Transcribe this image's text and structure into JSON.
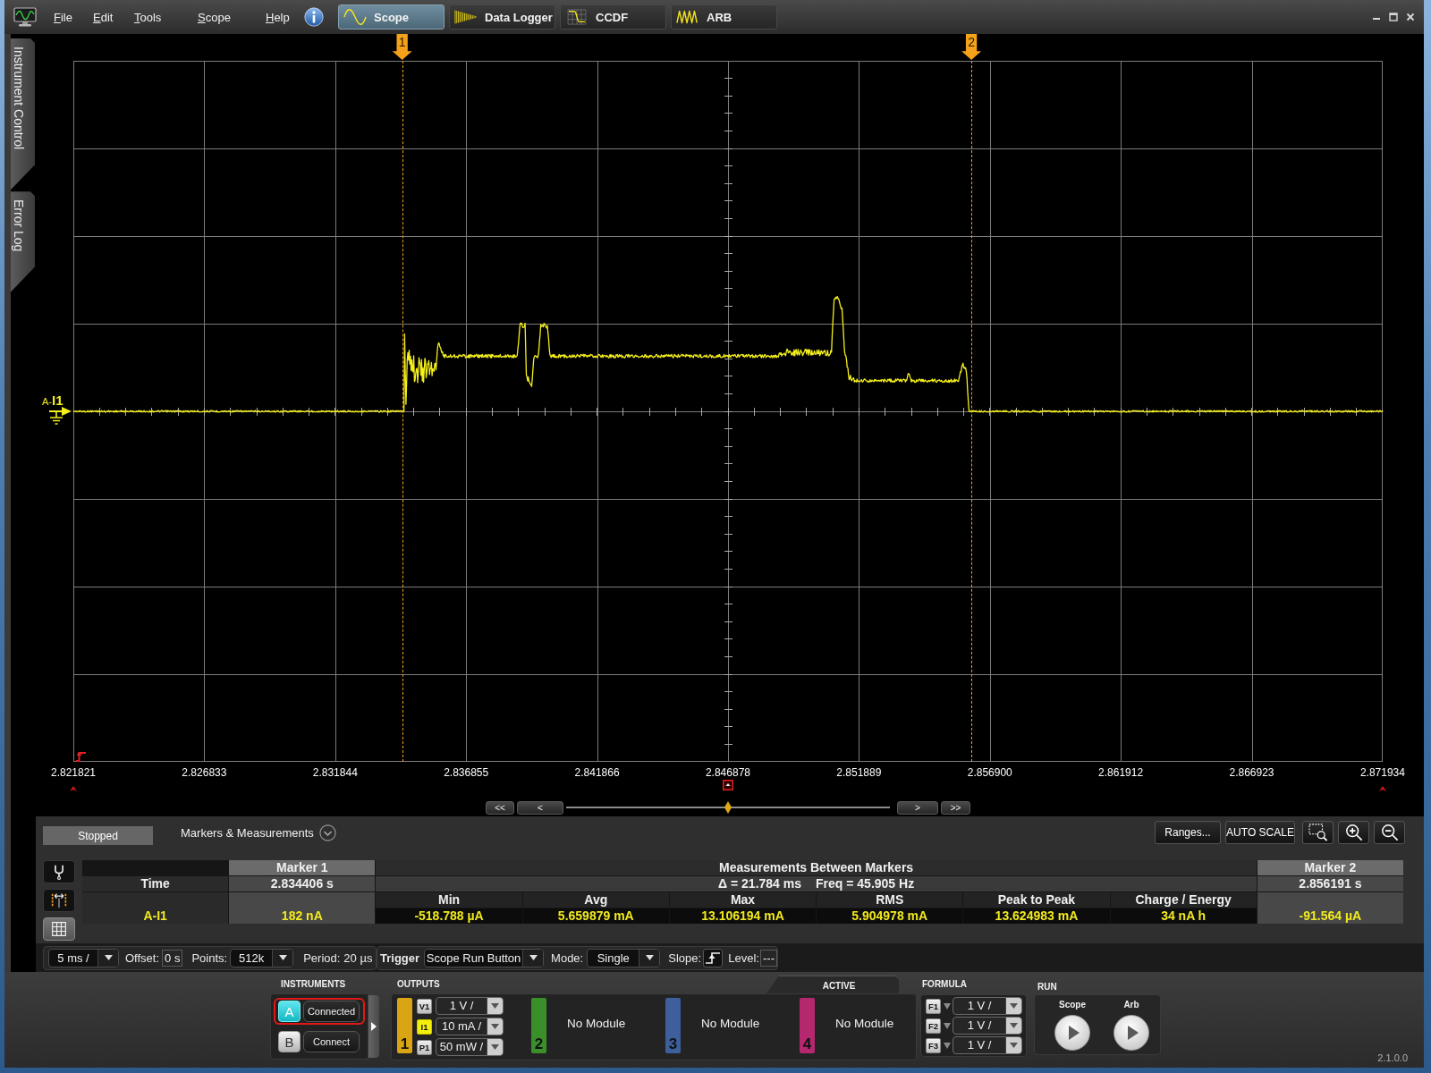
{
  "menu": [
    {
      "label": "File"
    },
    {
      "label": "Edit"
    },
    {
      "label": "Tools"
    },
    {
      "label": "Scope"
    },
    {
      "label": "Help"
    }
  ],
  "mode_tabs": [
    {
      "label": "Scope",
      "kind": "scope",
      "selected": true
    },
    {
      "label": "Data Logger",
      "kind": "logger",
      "selected": false
    },
    {
      "label": "CCDF",
      "kind": "ccdf",
      "selected": false
    },
    {
      "label": "ARB",
      "kind": "arb",
      "selected": false
    }
  ],
  "side_tabs": [
    {
      "label": "Instrument Control"
    },
    {
      "label": "Error Log"
    }
  ],
  "plot": {
    "channel_label": "A-**I1**",
    "markers": [
      {
        "label": "1"
      },
      {
        "label": "2"
      }
    ],
    "x_labels": [
      "2.821821",
      "2.826833",
      "2.831844",
      "2.836855",
      "2.841866",
      "2.846878",
      "2.851889",
      "2.856900",
      "2.861912",
      "2.866923",
      "2.871934"
    ]
  },
  "navigator": {
    "left_buttons": [
      "<<",
      "<"
    ],
    "right_buttons": [
      ">",
      ">>"
    ],
    "level": 0.5
  },
  "panel": {
    "status": "Stopped",
    "section": "Markers & Measurements",
    "buttons": [
      "Ranges...",
      "AUTO SCALE"
    ]
  },
  "tools": [
    {
      "kind": "probe",
      "selected": false
    },
    {
      "kind": "span",
      "selected": false
    },
    {
      "kind": "grid",
      "selected": true
    }
  ],
  "measurements": {
    "row_labels": {
      "time": "Time",
      "channel": "A-I1"
    },
    "marker_1": {
      "title": "Marker 1",
      "time": "2.834406 s",
      "value": "182 nA"
    },
    "between": {
      "title": "Measurements Between Markers",
      "delta": "Δ = 21.784 ms",
      "freq": "Freq = 45.905 Hz",
      "columns": [
        {
          "label": "Min",
          "value": "-518.788 µA"
        },
        {
          "label": "Avg",
          "value": "5.659879 mA"
        },
        {
          "label": "Max",
          "value": "13.106194 mA"
        },
        {
          "label": "RMS",
          "value": "5.904978 mA"
        },
        {
          "label": "Peak to Peak",
          "value": "13.624983 mA"
        },
        {
          "label": "Charge / Energy",
          "value": "34 nA h"
        }
      ]
    },
    "marker_2": {
      "title": "Marker 2",
      "time": "2.856191 s",
      "value": "-91.564 µA"
    }
  },
  "toolbar": {
    "timebase": "5 ms /",
    "offset": {
      "label": "Offset:",
      "value": "0 s"
    },
    "points": {
      "label": "Points:",
      "value": "512k"
    },
    "period": {
      "label": "Period:",
      "value": "20 µs"
    },
    "trigger": {
      "label": "Trigger",
      "value": "Scope Run Button"
    },
    "mode": {
      "label": "Mode:",
      "value": "Single"
    },
    "slope": {
      "label": "Slope:"
    },
    "level": {
      "label": "Level:",
      "value": "---"
    }
  },
  "instruments": {
    "title": "INSTRUMENTS",
    "items": [
      {
        "letter": "A",
        "action": "Connected",
        "connected": true,
        "selected": true
      },
      {
        "letter": "B",
        "action": "Connect",
        "connected": false,
        "selected": false
      }
    ]
  },
  "outputs": {
    "title": "OUTPUTS",
    "tab": "ACTIVE",
    "slots": [
      {
        "number": "1",
        "color": "#d9a514",
        "kind": "module",
        "channels": [
          {
            "tag": "V1",
            "scale": "1 V /",
            "selected": false
          },
          {
            "tag": "I1",
            "scale": "10 mA /",
            "selected": true
          },
          {
            "tag": "P1",
            "scale": "50 mW /",
            "selected": false
          }
        ]
      },
      {
        "number": "2",
        "color": "#3a8f2a",
        "kind": "empty",
        "status": "No Module"
      },
      {
        "number": "3",
        "color": "#3d5f9c",
        "kind": "empty",
        "status": "No Module"
      },
      {
        "number": "4",
        "color": "#b5286f",
        "kind": "empty",
        "status": "No Module"
      }
    ]
  },
  "formula": {
    "title": "FORMULA",
    "items": [
      {
        "tag": "F1",
        "scale": "1 V /"
      },
      {
        "tag": "F2",
        "scale": "1 V /"
      },
      {
        "tag": "F3",
        "scale": "1 V /"
      }
    ]
  },
  "run": {
    "title": "RUN",
    "buttons": [
      {
        "label": "Scope"
      },
      {
        "label": "Arb"
      }
    ]
  },
  "version": "2.1.0.0"
}
